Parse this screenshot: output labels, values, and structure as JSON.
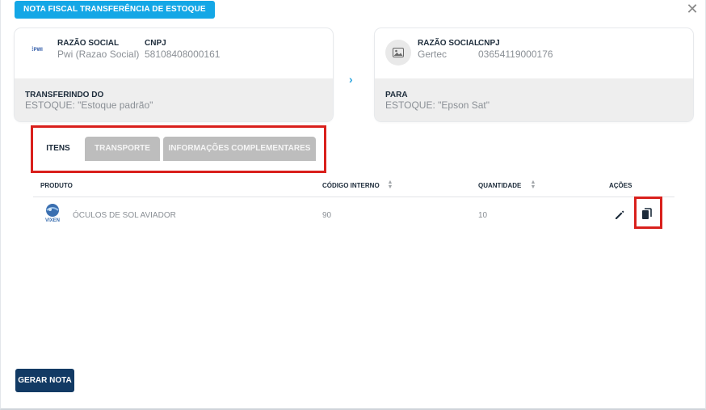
{
  "modal": {
    "title": "NOTA FISCAL TRANSFERÊNCIA DE ESTOQUE",
    "close_icon": "close-icon"
  },
  "origin": {
    "logo_text": "PWI",
    "razao_label": "RAZÃO SOCIAL",
    "razao_value": "Pwi (Razao Social)",
    "cnpj_label": "CNPJ",
    "cnpj_value": "58108408000161",
    "section_label": "TRANSFERINDO DO",
    "section_value": "ESTOQUE: \"Estoque padrão\""
  },
  "destination": {
    "image_icon": "image-placeholder-icon",
    "razao_label": "RAZÃO SOCIAL",
    "razao_value": "Gertec",
    "cnpj_label": "CNPJ",
    "cnpj_value": "03654119000176",
    "section_label": "PARA",
    "section_value": "ESTOQUE: \"Epson Sat\""
  },
  "arrow_icon": "chevron-right-icon",
  "tabs": [
    {
      "label": "ITENS",
      "active": true
    },
    {
      "label": "TRANSPORTE",
      "active": false
    },
    {
      "label": "INFORMAÇÕES COMPLEMENTARES",
      "active": false
    }
  ],
  "table": {
    "headers": [
      "PRODUTO",
      "CÓDIGO INTERNO",
      "QUANTIDADE",
      "AÇÕES"
    ],
    "rows": [
      {
        "image_caption": "VIXEN",
        "produto": "ÓCULOS DE SOL AVIADOR",
        "codigo_interno": "90",
        "quantidade": "10"
      }
    ]
  },
  "actions": {
    "gerar_label": "GERAR NOTA"
  },
  "colors": {
    "accent": "#14a7e6",
    "primary": "#123a64",
    "highlight": "#d9201c",
    "tab_inactive": "#bdbdbd"
  }
}
